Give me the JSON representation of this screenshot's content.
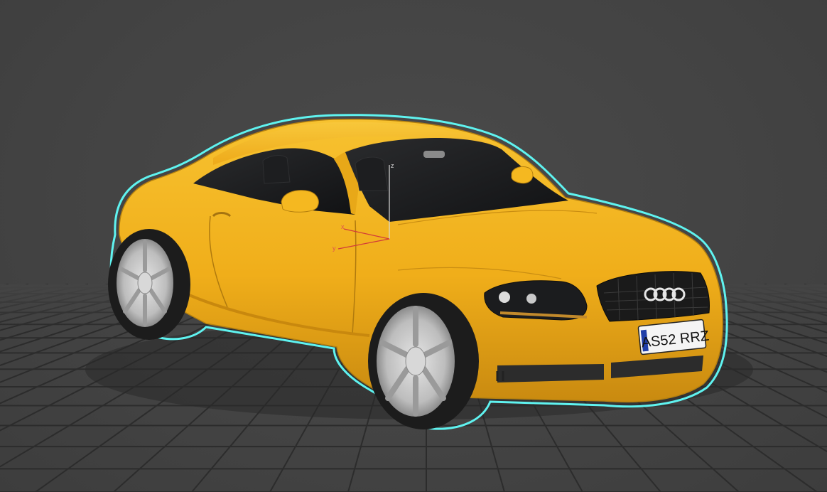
{
  "viewport": {
    "background": "#444444",
    "grid_color": "#2c2c2c",
    "selection_outline_color": "#5ff3f0"
  },
  "model": {
    "body_color": "#f2b01b",
    "license_plate": "AS52 RRZ",
    "gizmo_axes": {
      "x_label": "x",
      "y_label": "y",
      "z_label": "z"
    }
  }
}
